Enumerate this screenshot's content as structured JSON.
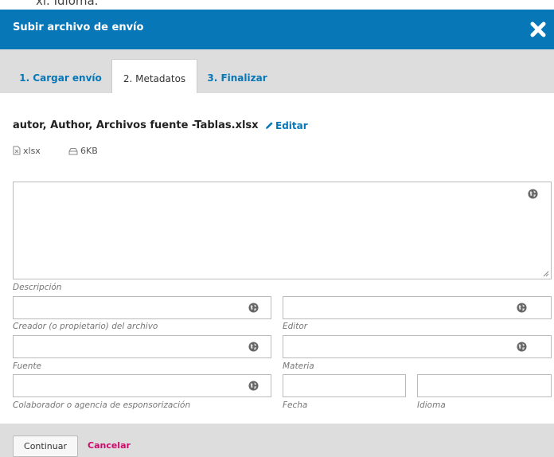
{
  "background_peek": {
    "text": "xi.    Idioma."
  },
  "modal": {
    "title": "Subir archivo de envío",
    "close_icon": "close-x-icon"
  },
  "tabs": [
    {
      "label": "1. Cargar envío",
      "active": false
    },
    {
      "label": "2. Metadatos",
      "active": true
    },
    {
      "label": "3. Finalizar",
      "active": false
    }
  ],
  "file": {
    "name": "autor, Author, Archivos fuente -Tablas.xlsx",
    "edit_label": "Editar",
    "type": "xlsx",
    "size": "6KB"
  },
  "form": {
    "description_label": "Descripción",
    "creator_label": "Creador (o propietario) del archivo",
    "publisher_label": "Editor",
    "source_label": "Fuente",
    "subject_label": "Materia",
    "sponsor_label": "Colaborador o agencia de esponsorización",
    "date_label": "Fecha",
    "language_label": "Idioma",
    "description_value": "",
    "creator_value": "",
    "publisher_value": "",
    "source_value": "",
    "subject_value": "",
    "sponsor_value": "",
    "date_value": "",
    "language_value": ""
  },
  "footer": {
    "continue_label": "Continuar",
    "cancel_label": "Cancelar"
  },
  "colors": {
    "header": "#0777b8",
    "tabs_bg": "#dddddd",
    "link": "#0777b8",
    "cancel": "#d00a6c"
  }
}
